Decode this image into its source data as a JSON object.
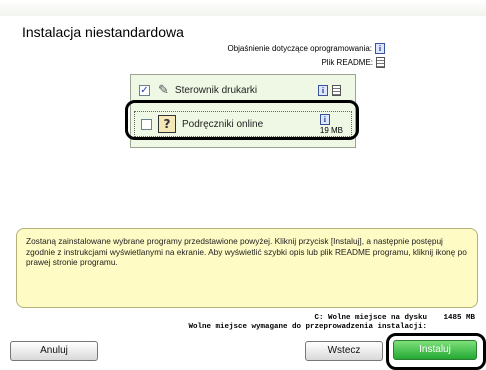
{
  "title": "Instalacja niestandardowa",
  "info": {
    "software_desc_label": "Objaśnienie dotyczące oprogramowania:",
    "readme_label": "Plik README:"
  },
  "components": [
    {
      "label": "Sterownik drukarki",
      "checked": true,
      "mark": "✓"
    },
    {
      "label": "Podręczniki online",
      "checked": false,
      "size": "19 MB"
    }
  ],
  "description": "Zostaną zainstalowane wybrane programy przedstawione powyżej. Kliknij przycisk [Instaluj], a następnie postępuj zgodnie z instrukcjami wyświetlanymi na ekranie. Aby wyświetlić szybki opis lub plik README programu, kliknij ikonę po prawej stronie programu.",
  "disk": {
    "free_label": "C: Wolne miejsce na dysku",
    "free_value": "1485 MB",
    "required_label": "Wolne miejsce wymagane do przeprowadzenia instalacji:"
  },
  "buttons": {
    "cancel": "Anuluj",
    "back": "Wstecz",
    "install": "Instaluj"
  },
  "colors": {
    "install_button": "#24a833",
    "info_panel": "#fffbc4",
    "list_background": "#eef8e4"
  },
  "icons": {
    "info": "info-icon",
    "readme": "readme-icon",
    "printer_driver": "printer-driver-icon",
    "manual": "manual-icon"
  }
}
